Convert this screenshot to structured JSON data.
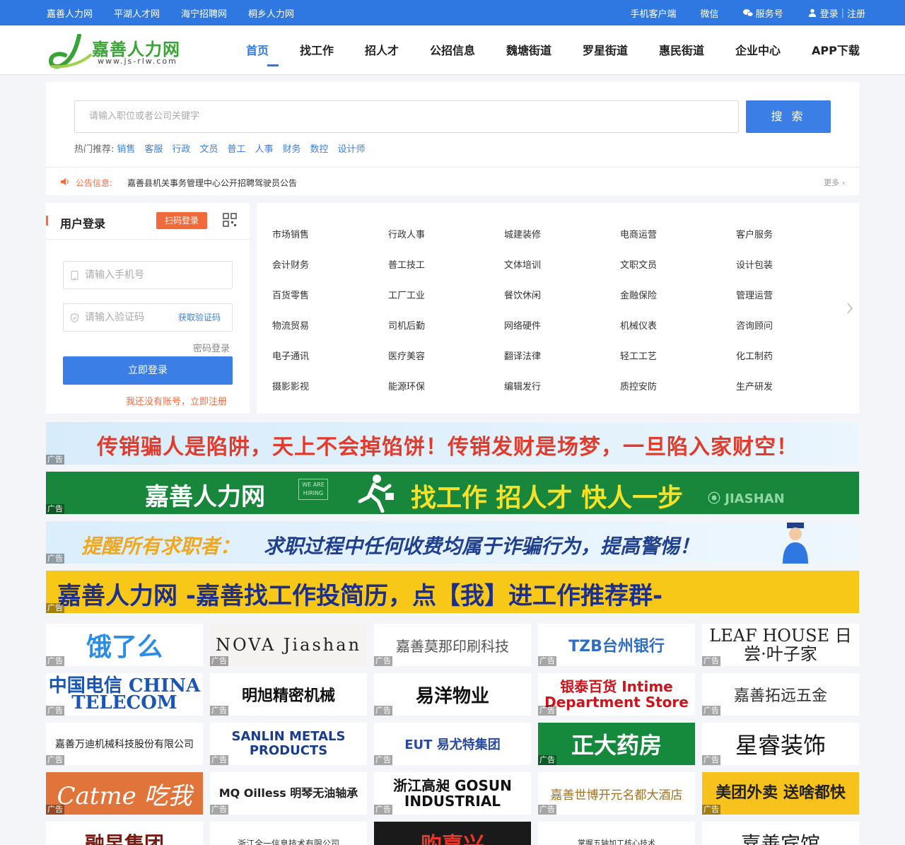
{
  "topbar": {
    "links": [
      "嘉善人力网",
      "平湖人才网",
      "海宁招聘网",
      "桐乡人力网"
    ],
    "mobile": "手机客户端",
    "wechat": "微信",
    "service": "服务号",
    "login": "登录",
    "register": "注册"
  },
  "header": {
    "logo_text": "嘉善人力网",
    "logo_url": "www.js-rlw.com",
    "nav": [
      "首页",
      "找工作",
      "招人才",
      "公招信息",
      "魏塘街道",
      "罗星街道",
      "惠民街道",
      "企业中心",
      "APP下载"
    ]
  },
  "search": {
    "placeholder": "请输入职位或者公司关键字",
    "button": "搜 索",
    "hot_label": "热门推荐:",
    "hot": [
      "销售",
      "客服",
      "行政",
      "文员",
      "普工",
      "人事",
      "财务",
      "数控",
      "设计师"
    ]
  },
  "notice": {
    "label": "公告信息:",
    "text": "嘉善县机关事务管理中心公开招聘驾驶员公告",
    "more": "更多"
  },
  "login": {
    "title": "用户登录",
    "scan": "扫码登录",
    "phone_placeholder": "请输入手机号",
    "code_placeholder": "请输入验证码",
    "get_code": "获取验证码",
    "pwd_login": "密码登录",
    "submit": "立即登录",
    "register": "我还没有账号，立即注册"
  },
  "categories": [
    [
      "市场销售",
      "行政人事",
      "城建装修",
      "电商运营",
      "客户服务"
    ],
    [
      "会计财务",
      "普工技工",
      "文体培训",
      "文职文员",
      "设计包装"
    ],
    [
      "百货零售",
      "工厂工业",
      "餐饮休闲",
      "金融保险",
      "管理运营"
    ],
    [
      "物流贸易",
      "司机后勤",
      "网络硬件",
      "机械仪表",
      "咨询顾问"
    ],
    [
      "电子通讯",
      "医疗美容",
      "翻译法律",
      "轻工工艺",
      "化工制药"
    ],
    [
      "摄影影视",
      "能源环保",
      "编辑发行",
      "质控安防",
      "生产研发"
    ]
  ],
  "banners": {
    "ad_label": "广告",
    "b1": "传销骗人是陷阱，天上不会掉馅饼！传销发财是场梦，一旦陷入家财空！",
    "b2_a": "嘉善人力网",
    "b2_hire": "WE ARE HIRING",
    "b2_b": "找工作 招人才 快人一步",
    "b2_c": "JIASHAN",
    "b3_a": "提醒所有求职者：",
    "b3_b": "求职过程中任何收费均属于诈骗行为，提高警惕！",
    "b4": "嘉善人力网 -嘉善找工作投简历，点【我】进工作推荐群-"
  },
  "logo_ads": [
    [
      "饿了么",
      "NOVA Jiashan",
      "嘉善莫那印刷科技",
      "TZB台州银行",
      "LEAF HOUSE 日尝·叶子家"
    ],
    [
      "中国电信 CHINA TELECOM",
      "明旭精密机械",
      "易洋物业",
      "银泰百货 Intime Department Store",
      "嘉善拓远五金"
    ],
    [
      "嘉善万迪机械科技股份有限公司",
      "SANLIN METALS PRODUCTS",
      "EUT 易尤特集团",
      "正大药房",
      "星睿装饰"
    ],
    [
      "Catme 吃我",
      "MQ Oilless 明琴无油轴承",
      "浙江高昶 GOSUN INDUSTRIAL",
      "嘉善世博开元名都大酒店",
      "美团外卖 送啥都快"
    ],
    [
      "融昱集团",
      "浙江全一信息技术有限公司",
      "购嘉兴",
      "掌握五轴加工核心技术",
      "嘉善宾馆"
    ]
  ],
  "colors": {
    "brand": "#2f78e2",
    "accent": "#ff6a3d",
    "logo_green": "#3aa335"
  }
}
